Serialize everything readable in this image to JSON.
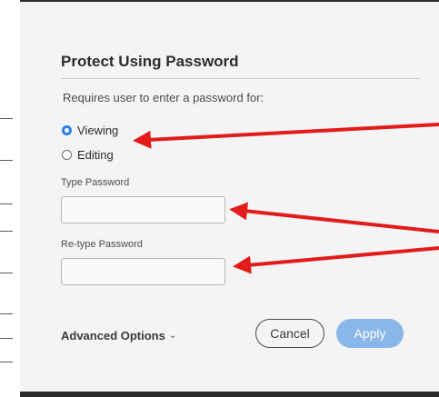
{
  "dialog": {
    "title": "Protect Using Password",
    "subtitle": "Requires user to enter a password for:",
    "options": [
      {
        "label": "Viewing",
        "selected": true
      },
      {
        "label": "Editing",
        "selected": false
      }
    ],
    "type_password_label": "Type Password",
    "type_password_value": "",
    "retype_password_label": "Re-type Password",
    "retype_password_value": "",
    "advanced_options_label": "Advanced Options",
    "cancel_label": "Cancel",
    "apply_label": "Apply"
  },
  "colors": {
    "accent": "#2b7fe0",
    "apply_disabled": "#8ab7ea",
    "annotation_arrow": "#e21b1b",
    "dialog_bg": "#f4f4f4",
    "frame": "#2b2b2b"
  },
  "icons": {
    "advanced_chevron": "chevron-down-icon"
  }
}
